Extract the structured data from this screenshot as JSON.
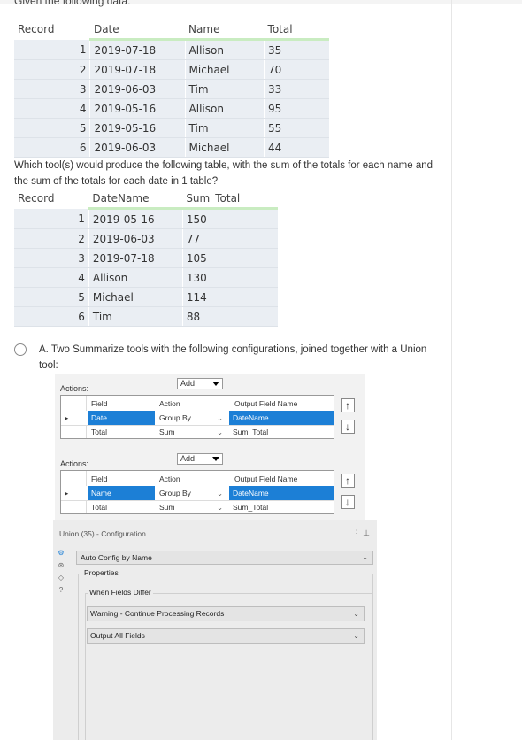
{
  "intro_text": "Given the following data:",
  "table1": {
    "headers": [
      "Record",
      "Date",
      "Name",
      "Total"
    ],
    "rows": [
      [
        "1",
        "2019-07-18",
        "Allison",
        "35"
      ],
      [
        "2",
        "2019-07-18",
        "Michael",
        "70"
      ],
      [
        "3",
        "2019-06-03",
        "Tim",
        "33"
      ],
      [
        "4",
        "2019-05-16",
        "Allison",
        "95"
      ],
      [
        "5",
        "2019-05-16",
        "Tim",
        "55"
      ],
      [
        "6",
        "2019-06-03",
        "Michael",
        "44"
      ]
    ]
  },
  "question": "Which tool(s) would produce the following table, with the sum of the totals for each name and the sum of the totals for each date in 1 table?",
  "table2": {
    "headers": [
      "Record",
      "DateName",
      "Sum_Total"
    ],
    "rows": [
      [
        "1",
        "2019-05-16",
        "150"
      ],
      [
        "2",
        "2019-06-03",
        "77"
      ],
      [
        "3",
        "2019-07-18",
        "105"
      ],
      [
        "4",
        "Allison",
        "130"
      ],
      [
        "5",
        "Michael",
        "114"
      ],
      [
        "6",
        "Tim",
        "88"
      ]
    ]
  },
  "option_a": "A. Two Summarize tools with the following configurations, joined together with a Union tool:",
  "summarize1": {
    "actions_label": "Actions:",
    "add_label": "Add",
    "col_field": "Field",
    "col_action": "Action",
    "col_output": "Output Field Name",
    "rows": [
      {
        "field": "Date",
        "action": "Group By",
        "output": "DateName"
      },
      {
        "field": "Total",
        "action": "Sum",
        "output": "Sum_Total"
      }
    ]
  },
  "summarize2": {
    "actions_label": "Actions:",
    "add_label": "Add",
    "col_field": "Field",
    "col_action": "Action",
    "col_output": "Output Field Name",
    "rows": [
      {
        "field": "Name",
        "action": "Group By",
        "output": "DateName"
      },
      {
        "field": "Total",
        "action": "Sum",
        "output": "Sum_Total"
      }
    ]
  },
  "union": {
    "title": "Union (35) - Configuration",
    "mode": "Auto Config by Name",
    "properties_label": "Properties",
    "fields_differ_label": "When Fields Differ",
    "fields_differ_value": "Warning - Continue Processing Records",
    "output_value": "Output All Fields"
  },
  "icons": {
    "pointer": "row-pointer-icon",
    "up": "move-up-icon",
    "down": "move-down-icon"
  },
  "colors": {
    "selected_row": "#1c7fd6",
    "header_underline": "#c9ecc1",
    "cell_bg": "#eaeef3"
  }
}
